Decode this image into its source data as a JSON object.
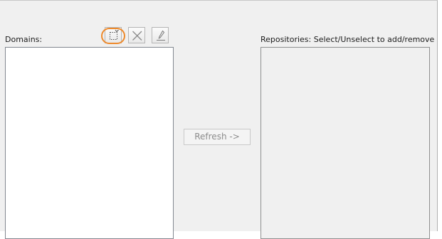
{
  "domains": {
    "label": "Domains:",
    "items": []
  },
  "toolbar": {
    "new_icon": "new-domain-icon",
    "delete_icon": "delete-x-icon",
    "edit_icon": "edit-pencil-icon",
    "highlight_color": "#ee8a2c"
  },
  "refresh": {
    "label": "Refresh ->"
  },
  "repositories": {
    "label": "Repositories: Select/Unselect to add/remove",
    "items": []
  }
}
